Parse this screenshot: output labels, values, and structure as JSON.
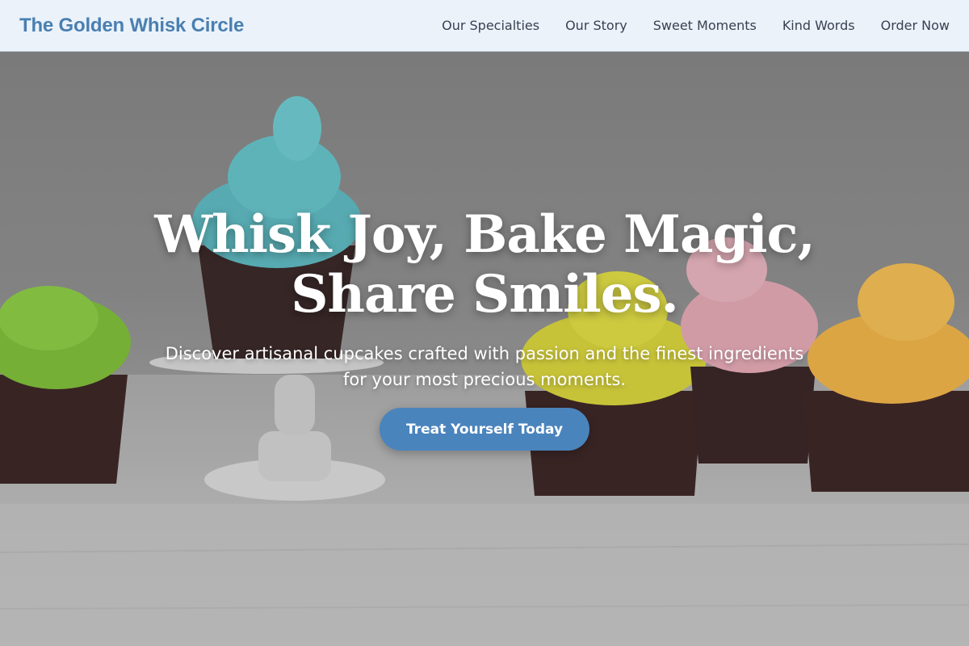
{
  "header": {
    "brand": "The Golden Whisk Circle",
    "nav": [
      {
        "label": "Our Specialties"
      },
      {
        "label": "Our Story"
      },
      {
        "label": "Sweet Moments"
      },
      {
        "label": "Kind Words"
      },
      {
        "label": "Order Now"
      }
    ]
  },
  "hero": {
    "title_line1": "Whisk Joy, Bake Magic,",
    "title_line2": "Share Smiles.",
    "subtitle_line1": "Discover artisanal cupcakes crafted with passion and the finest ingredients",
    "subtitle_line2": "for your most precious moments.",
    "cta_label": "Treat Yourself Today",
    "image_icon": "cupcakes-photo"
  },
  "colors": {
    "brand": "#4a7fb0",
    "nav_bg": "#ebf2fa",
    "cta": "#4a84bd",
    "nav_text": "#374151"
  }
}
